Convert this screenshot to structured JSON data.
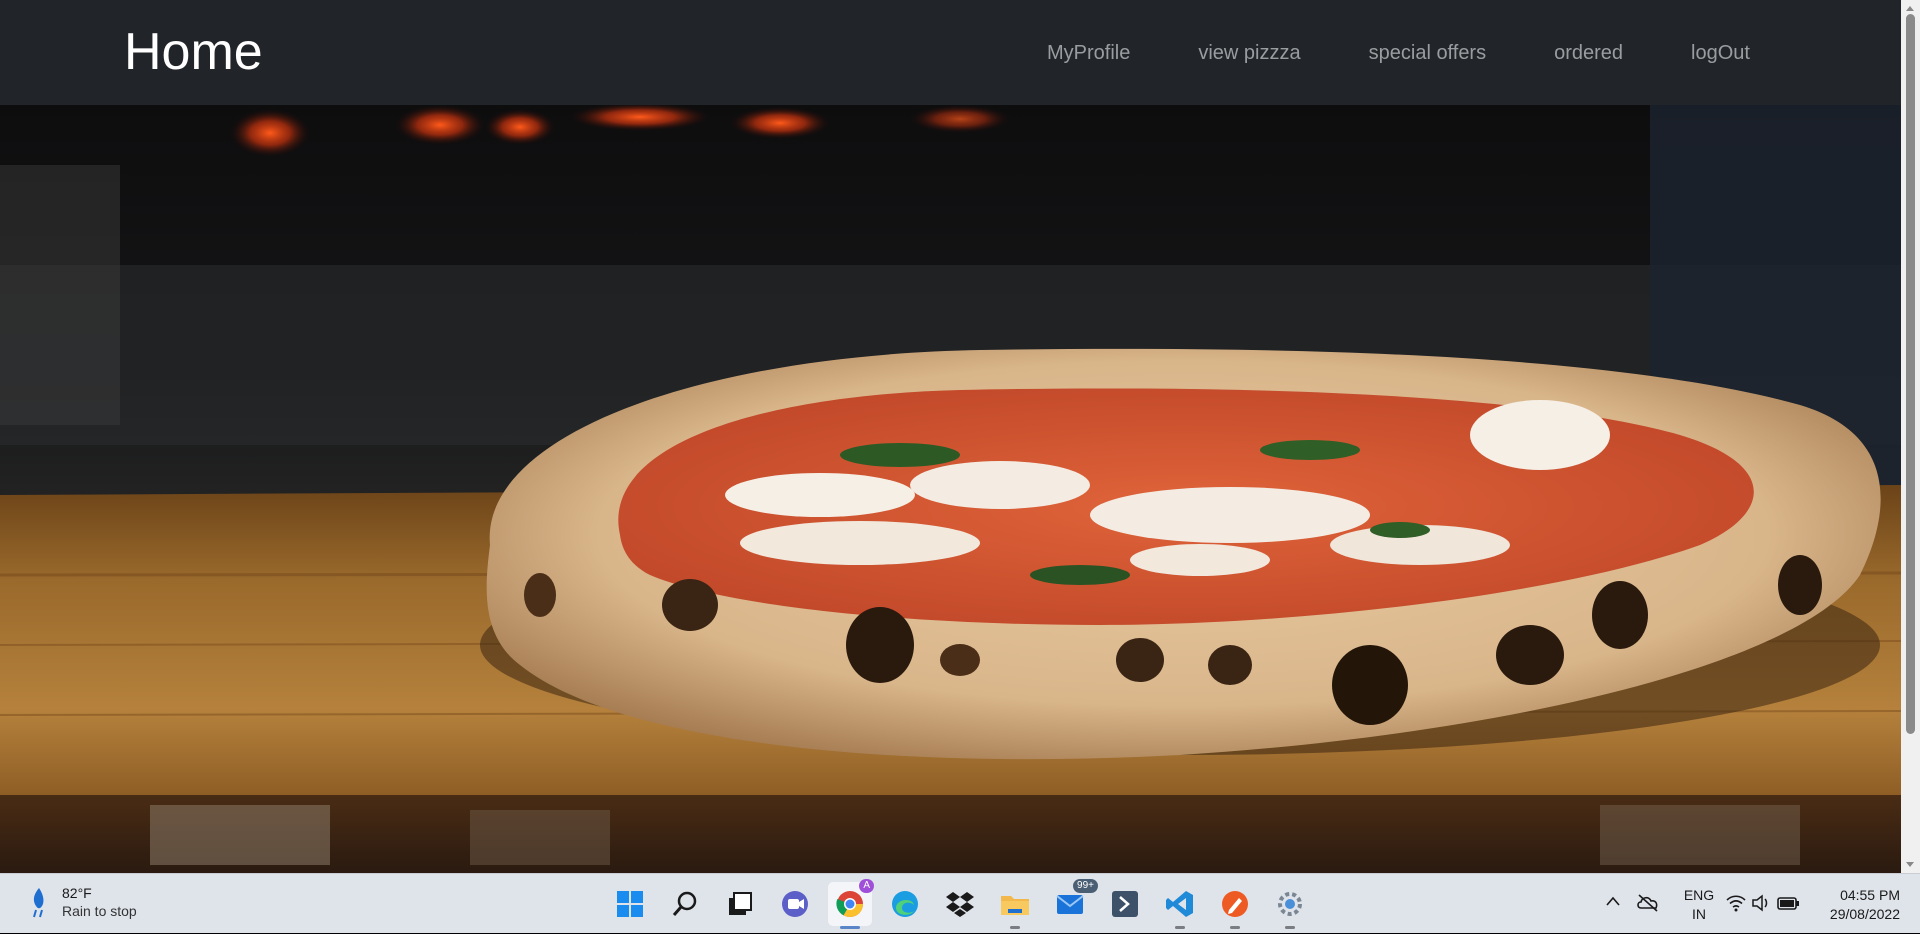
{
  "navbar": {
    "brand": "Home",
    "links": [
      "MyProfile",
      "view pizzza",
      "special offers",
      "ordered",
      "logOut"
    ]
  },
  "hero": {
    "image": "pizza-on-wooden-board-photo"
  },
  "taskbar": {
    "weather": {
      "temp": "82°F",
      "desc": "Rain to stop",
      "icon": "rain-icon"
    },
    "apps": [
      "windows-start-icon",
      "search-icon",
      "task-view-icon",
      "teams-chat-icon",
      "chrome-icon",
      "edge-icon",
      "dropbox-icon",
      "file-explorer-icon",
      "mail-icon",
      "powershell-icon",
      "vscode-icon",
      "sketch-icon",
      "settings-icon"
    ],
    "mail_badge": "99+",
    "chrome_badge": "A",
    "tray": {
      "lang_line1": "ENG",
      "lang_line2": "IN",
      "time": "04:55 PM",
      "date": "29/08/2022"
    }
  },
  "colors": {
    "navbar_bg": "#212529",
    "nav_link": "#9a9da0",
    "taskbar_bg": "#dfe3ea"
  }
}
